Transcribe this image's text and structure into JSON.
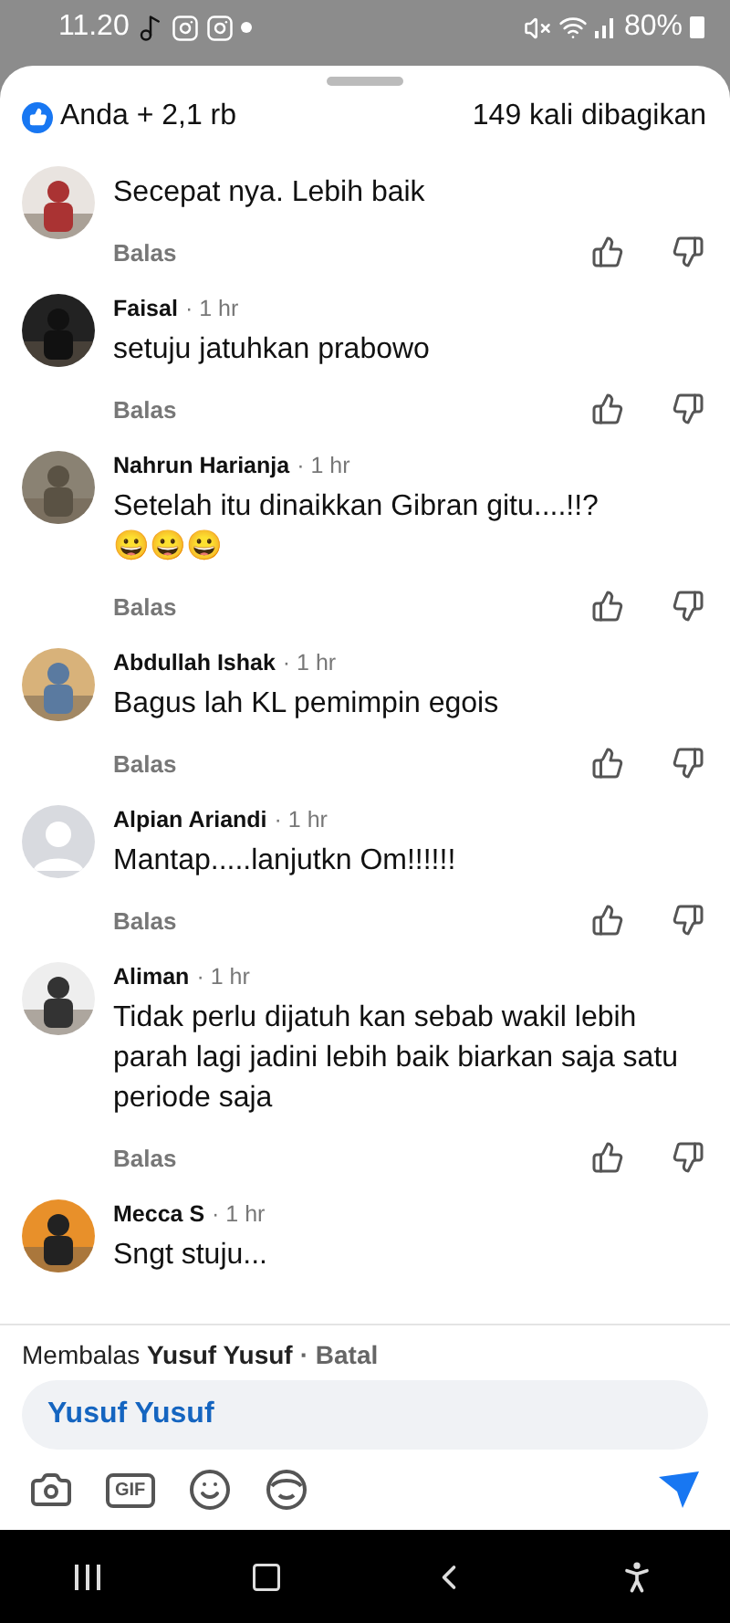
{
  "status_bar": {
    "time": "11.20",
    "battery": "80%"
  },
  "header": {
    "reactions": "Anda + 2,1 rb",
    "shares": "149 kali dibagikan"
  },
  "comments": [
    {
      "text": "Secepat nya. Lebih baik",
      "reply": "Balas"
    },
    {
      "name": "Faisal",
      "time": "· 1 hr",
      "text": "setuju jatuhkan prabowo",
      "reply": "Balas"
    },
    {
      "name": "Nahrun Harianja",
      "time": "· 1 hr",
      "text": "Setelah itu dinaikkan Gibran gitu....!!?\n😀😀😀",
      "reply": "Balas"
    },
    {
      "name": "Abdullah Ishak",
      "time": "· 1 hr",
      "text": "Bagus lah KL pemimpin egois",
      "reply": "Balas"
    },
    {
      "kind": "default",
      "name": "Alpian Ariandi",
      "time": "· 1 hr",
      "text": "Mantap.....lanjutkn Om!!!!!!",
      "reply": "Balas"
    },
    {
      "name": "Aliman",
      "time": "· 1 hr",
      "text": "Tidak perlu dijatuh kan sebab wakil lebih parah lagi jadini lebih baik biarkan saja satu periode saja",
      "reply": "Balas"
    },
    {
      "name": "Mecca S",
      "time": "· 1 hr",
      "text": "Sngt stuju..."
    }
  ],
  "composer": {
    "replying": "Membalas **Yusuf Yusuf**",
    "cancel": "· Batal",
    "value": "Yusuf Yusuf",
    "gif": "GIF"
  }
}
